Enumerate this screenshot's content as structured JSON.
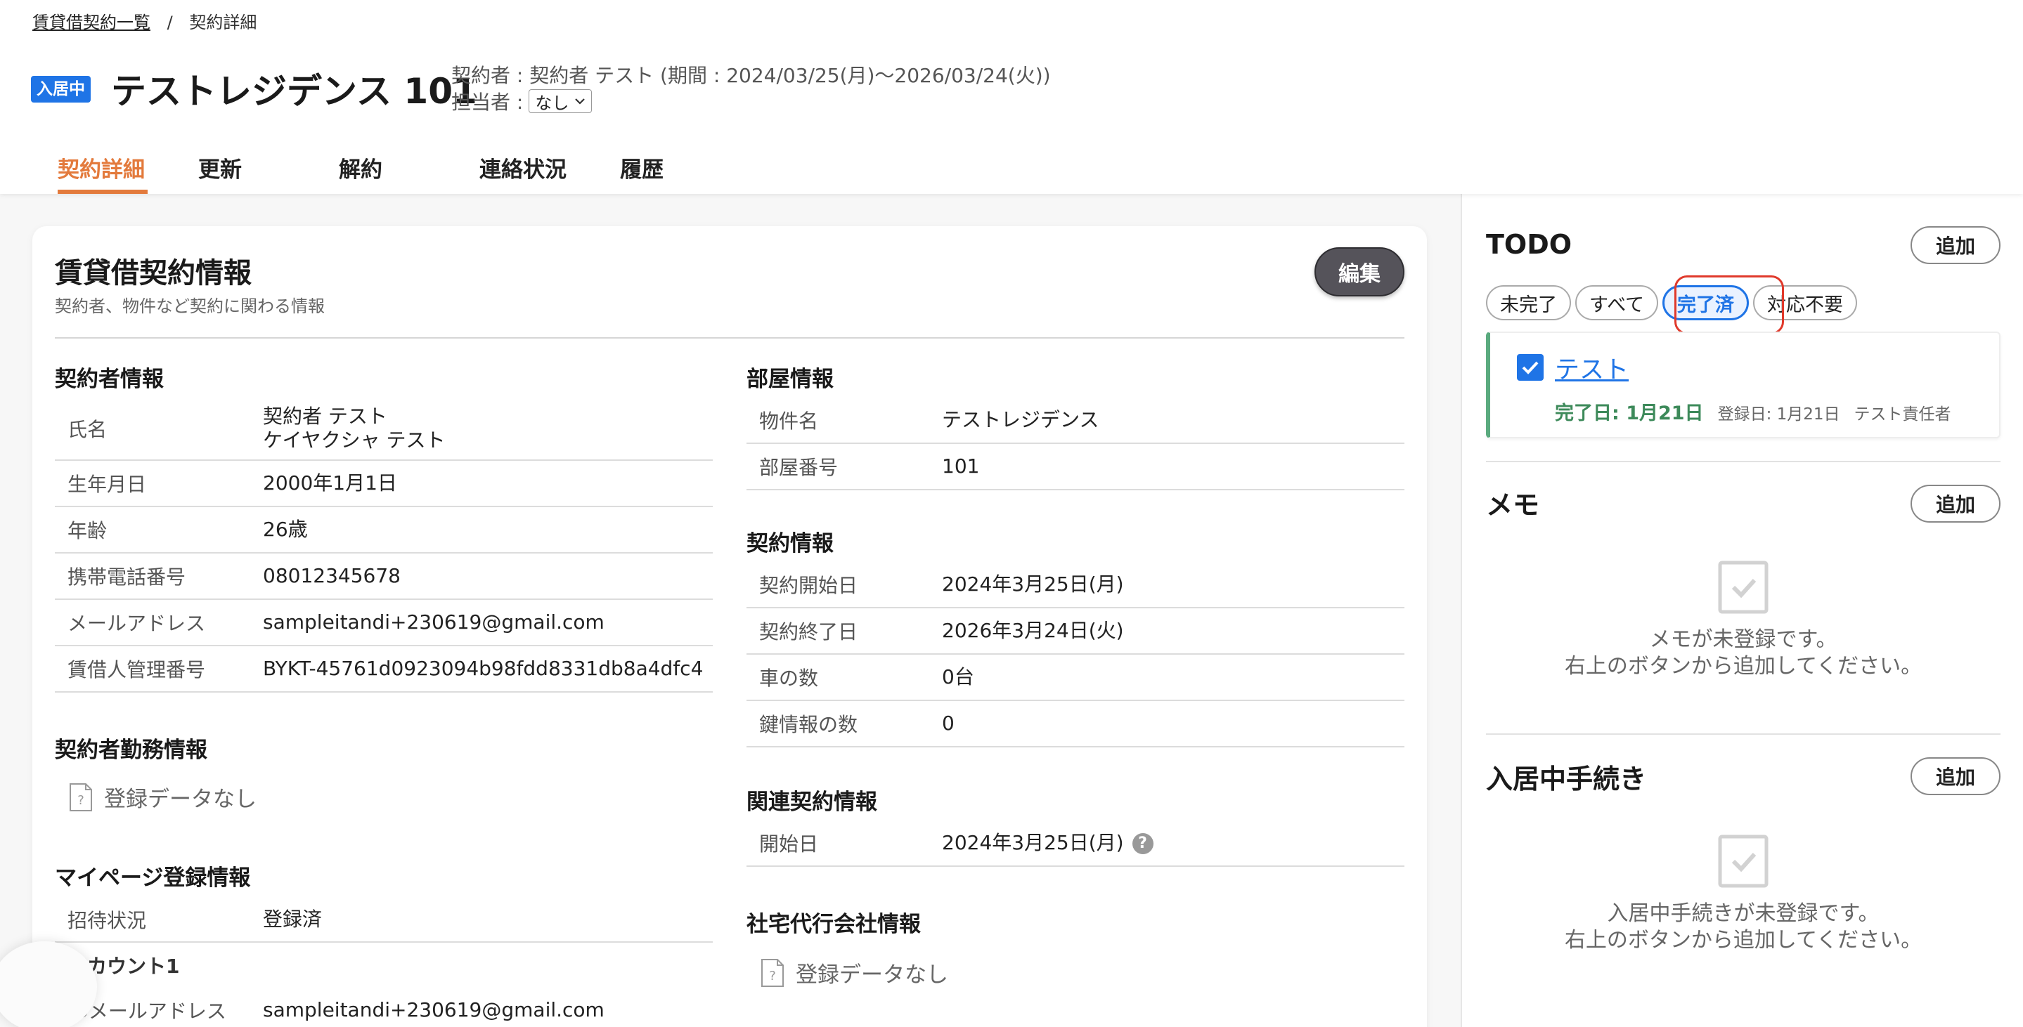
{
  "breadcrumb": {
    "parent": "賃貸借契約一覧",
    "separator": "/",
    "current": "契約詳細"
  },
  "header": {
    "status_badge": "入居中",
    "title": "テストレジデンス 101",
    "contract_meta": "契約者 : 契約者 テスト (期間 : 2024/03/25(月)〜2026/03/24(火))",
    "assignee_label": "担当者 :",
    "assignee_value": "なし"
  },
  "tabs": [
    "契約詳細",
    "更新",
    "解約",
    "連絡状況",
    "履歴"
  ],
  "card": {
    "title": "賃貸借契約情報",
    "subtitle": "契約者、物件など契約に関わる情報",
    "edit_label": "編集"
  },
  "contractor": {
    "title": "契約者情報",
    "rows": [
      {
        "label": "氏名",
        "value": "契約者 テスト",
        "value2": "ケイヤクシャ テスト"
      },
      {
        "label": "生年月日",
        "value": "2000年1月1日"
      },
      {
        "label": "年齢",
        "value": "26歳"
      },
      {
        "label": "携帯電話番号",
        "value": "08012345678"
      },
      {
        "label": "メールアドレス",
        "value": "sampleitandi+230619@gmail.com"
      },
      {
        "label": "賃借人管理番号",
        "value": "BYKT-45761d0923094b98fdd8331db8a4dfc4"
      }
    ]
  },
  "employment": {
    "title": "契約者勤務情報",
    "empty": "登録データなし"
  },
  "mypage": {
    "title": "マイページ登録情報",
    "rows": [
      {
        "label": "招待状況",
        "value": "登録済"
      }
    ],
    "account_label": "アカウント1",
    "email_label": "IDメールアドレス",
    "email_value": "sampleitandi+230619@gmail.com"
  },
  "room": {
    "title": "部屋情報",
    "rows": [
      {
        "label": "物件名",
        "value": "テストレジデンス"
      },
      {
        "label": "部屋番号",
        "value": "101"
      }
    ]
  },
  "contract": {
    "title": "契約情報",
    "rows": [
      {
        "label": "契約開始日",
        "value": "2024年3月25日(月)"
      },
      {
        "label": "契約終了日",
        "value": "2026年3月24日(火)"
      },
      {
        "label": "車の数",
        "value": "0台"
      },
      {
        "label": "鍵情報の数",
        "value": "0"
      }
    ]
  },
  "related": {
    "title": "関連契約情報",
    "rows": [
      {
        "label": "開始日",
        "value": "2024年3月25日(月)"
      }
    ],
    "help_glyph": "?"
  },
  "company_housing": {
    "title": "社宅代行会社情報",
    "empty": "登録データなし"
  },
  "todo": {
    "title": "TODO",
    "add_label": "追加",
    "filters": [
      "未完了",
      "すべて",
      "完了済",
      "対応不要"
    ],
    "active_filter": "完了済",
    "item": {
      "title": "テスト",
      "done_date": "完了日: 1月21日",
      "registered": "登録日: 1月21日",
      "owner": "テスト責任者"
    }
  },
  "memo": {
    "title": "メモ",
    "add_label": "追加",
    "empty_line1": "メモが未登録です。",
    "empty_line2": "右上のボタンから追加してください。"
  },
  "procedures": {
    "title": "入居中手続き",
    "add_label": "追加",
    "empty_line1": "入居中手続きが未登録です。",
    "empty_line2": "右上のボタンから追加してください。"
  },
  "colors": {
    "accent_orange": "#e37a3c",
    "brand_blue": "#1f74e6",
    "done_green": "#3d8a5a",
    "highlight_red": "#e0392b"
  }
}
